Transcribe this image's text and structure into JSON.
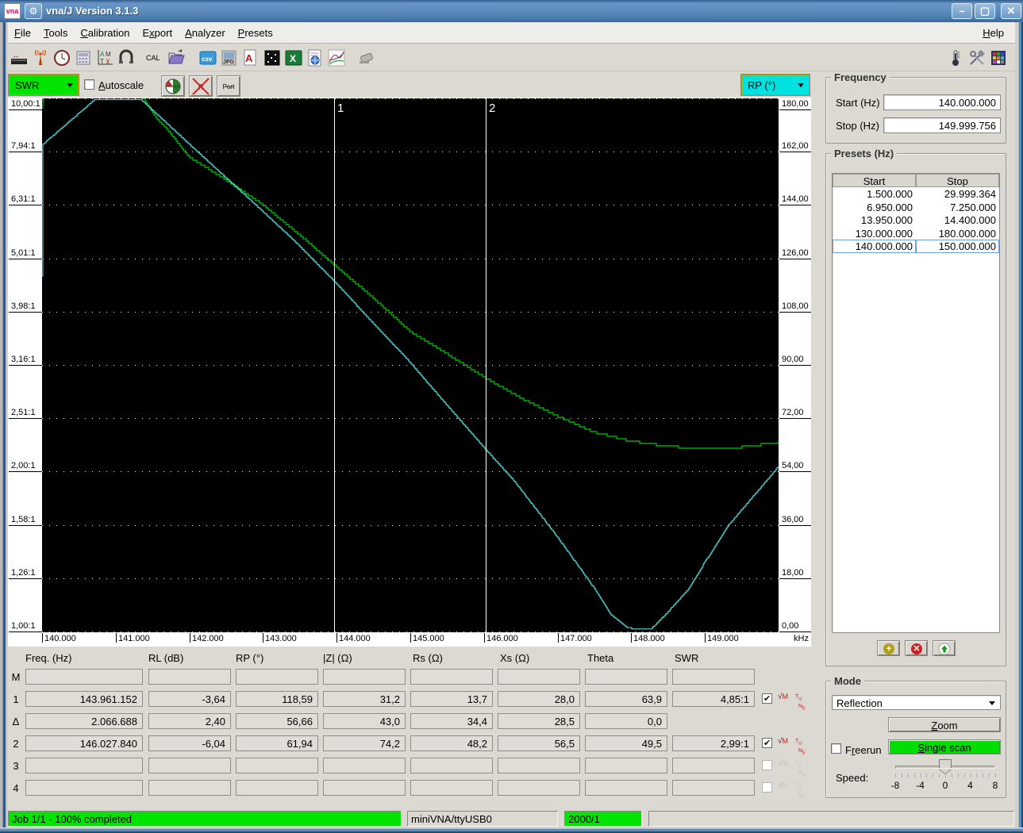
{
  "window": {
    "title": "vna/J Version 3.1.3",
    "buttons": {
      "minimize": "–",
      "maximize": "",
      "close": "×"
    }
  },
  "menu": {
    "items": [
      {
        "label": "File",
        "u": 0
      },
      {
        "label": "Tools",
        "u": 0
      },
      {
        "label": "Calibration",
        "u": 0
      },
      {
        "label": "Export",
        "u": 1
      },
      {
        "label": "Analyzer",
        "u": 0
      },
      {
        "label": "Presets",
        "u": 0
      }
    ],
    "help": {
      "label": "Help",
      "u": 0
    }
  },
  "toolbar": {
    "left_icons": [
      "frequency-ruler-icon",
      "antenna-icon",
      "clock-icon",
      "calculator-icon",
      "scale-setup-icon",
      "port-magnet-icon",
      "cal-icon",
      "open-folder-icon",
      "csv-export-icon",
      "jpg-export-icon",
      "pdf-export-icon",
      "snapshot-icon",
      "excel-export-icon",
      "report-icon",
      "chart-export-icon",
      "eraser-icon"
    ],
    "right_icons": [
      "thermometer-icon",
      "settings-tools-icon",
      "color-palette-icon"
    ]
  },
  "controls": {
    "left_scale": "SWR",
    "autoscale": {
      "label": "Autoscale",
      "u": 0,
      "checked": false
    },
    "right_scale": "RP (°)",
    "buttons": [
      "smith-chart-button",
      "ref-filter-off-button",
      "port-extension-off-button"
    ]
  },
  "chart": {
    "left_axis_labels": [
      "10,00:1",
      "7,94:1",
      "6,31:1",
      "5,01:1",
      "3,98:1",
      "3,16:1",
      "2,51:1",
      "2,00:1",
      "1,58:1",
      "1,26:1",
      "1,00:1"
    ],
    "right_axis_labels": [
      "180,00",
      "162,00",
      "144,00",
      "126,00",
      "108,00",
      "90,00",
      "72,00",
      "54,00",
      "36,00",
      "18,00",
      "0,00"
    ],
    "x_axis_labels": [
      "140.000",
      "141.000",
      "142.000",
      "143.000",
      "144.000",
      "145.000",
      "146.000",
      "147.000",
      "148.000",
      "149.000"
    ],
    "x_unit": "kHz",
    "markers": [
      {
        "id": "1",
        "freq_mhz": 143.961152
      },
      {
        "id": "2",
        "freq_mhz": 146.02784
      }
    ]
  },
  "chart_data": {
    "type": "line",
    "title": "",
    "x_axis": {
      "label": "kHz",
      "min_mhz": 140.0,
      "max_mhz": 150.0
    },
    "left_axis": {
      "label": "SWR",
      "scale": "log",
      "min": 1.0,
      "max": 10.0
    },
    "right_axis": {
      "label": "RP (°)",
      "scale": "linear",
      "min": 0,
      "max": 180
    },
    "series": [
      {
        "name": "SWR",
        "color": "#00cc00",
        "axis": "left",
        "points": [
          [
            140.0,
            9.55
          ],
          [
            140.05,
            11.5
          ],
          [
            141.28,
            11.5
          ],
          [
            141.38,
            10.0
          ],
          [
            141.55,
            9.2
          ],
          [
            141.7,
            8.75
          ],
          [
            142.0,
            7.76
          ],
          [
            142.42,
            7.15
          ],
          [
            143.0,
            6.32
          ],
          [
            143.5,
            5.55
          ],
          [
            143.961,
            4.885
          ],
          [
            144.49,
            4.24
          ],
          [
            145.0,
            3.66
          ],
          [
            145.52,
            3.31
          ],
          [
            146.028,
            2.99
          ],
          [
            146.54,
            2.73
          ],
          [
            147.0,
            2.54
          ],
          [
            147.5,
            2.37
          ],
          [
            148.0,
            2.28
          ],
          [
            148.5,
            2.23
          ],
          [
            148.9,
            2.21
          ],
          [
            149.3,
            2.21
          ],
          [
            149.6,
            2.23
          ],
          [
            150.0,
            2.27
          ]
        ]
      },
      {
        "name": "RP",
        "color": "#55dcdc",
        "axis": "right",
        "points": [
          [
            140.0,
            120
          ],
          [
            140.01,
            164.5
          ],
          [
            140.72,
            179.7
          ],
          [
            141.34,
            179.7
          ],
          [
            142.0,
            164.5
          ],
          [
            143.0,
            141.8
          ],
          [
            143.42,
            132.1
          ],
          [
            143.961,
            118.5
          ],
          [
            144.5,
            104.1
          ],
          [
            144.96,
            92.0
          ],
          [
            145.5,
            76.5
          ],
          [
            146.028,
            61.5
          ],
          [
            146.4,
            51.3
          ],
          [
            146.94,
            34.0
          ],
          [
            147.3,
            21.7
          ],
          [
            147.51,
            14.4
          ],
          [
            147.73,
            5.9
          ],
          [
            147.94,
            1.6
          ],
          [
            148.05,
            1.1
          ],
          [
            148.27,
            1.1
          ],
          [
            148.48,
            6.4
          ],
          [
            148.77,
            14.4
          ],
          [
            149.0,
            23.7
          ],
          [
            149.31,
            35.8
          ],
          [
            149.66,
            46.0
          ],
          [
            150.0,
            55.9
          ]
        ]
      }
    ]
  },
  "marker_table": {
    "headers": [
      "Freq. (Hz)",
      "RL (dB)",
      "RP (°)",
      "|Z| (Ω)",
      "Rs (Ω)",
      "Xs (Ω)",
      "Theta",
      "SWR"
    ],
    "rows": [
      {
        "label": "M",
        "freq": "",
        "rl": "",
        "rp": "",
        "z": "",
        "rs": "",
        "xs": "",
        "theta": "",
        "swr": "",
        "checkbox": null
      },
      {
        "label": "1",
        "freq": "143.961.152",
        "rl": "-3,64",
        "rp": "118,59",
        "z": "31,2",
        "rs": "13,7",
        "xs": "28,0",
        "theta": "63,9",
        "swr": "4,85:1",
        "checkbox": "checked"
      },
      {
        "label": "Δ",
        "freq": "2.066.688",
        "rl": "2,40",
        "rp": "56,66",
        "z": "43,0",
        "rs": "34,4",
        "xs": "28,5",
        "theta": "0,0",
        "swr": null,
        "checkbox": null
      },
      {
        "label": "2",
        "freq": "146.027.840",
        "rl": "-6,04",
        "rp": "61,94",
        "z": "74,2",
        "rs": "48,2",
        "xs": "56,5",
        "theta": "49,5",
        "swr": "2,99:1",
        "checkbox": "checked"
      },
      {
        "label": "3",
        "freq": "",
        "rl": "",
        "rp": "",
        "z": "",
        "rs": "",
        "xs": "",
        "theta": "",
        "swr": "",
        "checkbox": "disabled"
      },
      {
        "label": "4",
        "freq": "",
        "rl": "",
        "rp": "",
        "z": "",
        "rs": "",
        "xs": "",
        "theta": "",
        "swr": "",
        "checkbox": "disabled"
      }
    ]
  },
  "right_panel": {
    "frequency": {
      "title": "Frequency",
      "start_label": "Start (Hz)",
      "start_value": "140.000.000",
      "stop_label": "Stop (Hz)",
      "stop_value": "149.999.756"
    },
    "presets": {
      "title": "Presets (Hz)",
      "headers": [
        "Start",
        "Stop"
      ],
      "rows": [
        {
          "start": "1.500.000",
          "stop": "29.999.364",
          "selected": false
        },
        {
          "start": "6.950.000",
          "stop": "7.250.000",
          "selected": false
        },
        {
          "start": "13.950.000",
          "stop": "14.400.000",
          "selected": false
        },
        {
          "start": "130.000.000",
          "stop": "180.000.000",
          "selected": false
        },
        {
          "start": "140.000.000",
          "stop": "150.000.000",
          "selected": true
        }
      ],
      "buttons": [
        "add-preset-button",
        "delete-preset-button",
        "load-preset-button"
      ]
    },
    "mode": {
      "title": "Mode",
      "dropdown_value": "Reflection",
      "zoom_label": {
        "label": "Zoom",
        "u": 0
      },
      "freerun_label": {
        "label": "Freerun",
        "u": 1
      },
      "single_scan_label": {
        "label": "Single scan",
        "u": 0
      },
      "speed_label": "Speed:",
      "speed_ticks": [
        "-8",
        "-4",
        "0",
        "4",
        "8"
      ]
    }
  },
  "status_bar": {
    "job": "Job 1/1 - 100% completed",
    "device": "miniVNA/ttyUSB0",
    "counter": "2000/1"
  }
}
